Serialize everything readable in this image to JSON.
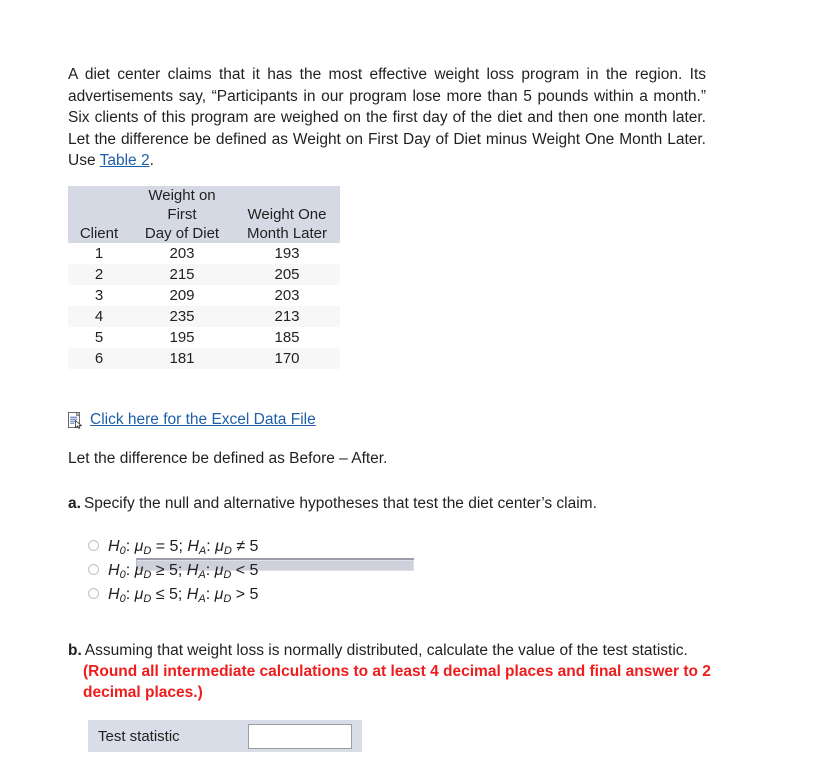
{
  "intro": {
    "line1": "A diet center claims that it has the most effective weight loss program in the",
    "line2": "region. Its advertisements say, “Participants in our program lose more than 5",
    "line3": "pounds within a month.” Six clients of this program are weighed on the first",
    "line4": "day of the diet and then one month later. Let the difference be defined as",
    "line5_before": "Weight on First Day of Diet minus Weight One Month Later. Use ",
    "table_link": "Table 2",
    "line5_after": "."
  },
  "table": {
    "headers": {
      "client": "Client",
      "first_day_l1": "Weight on",
      "first_day_l2": "First",
      "first_day_l3": "Day of Diet",
      "month_later_l1": "Weight One",
      "month_later_l2": "Month Later"
    },
    "rows": [
      {
        "client": "1",
        "first_day": "203",
        "month_later": "193"
      },
      {
        "client": "2",
        "first_day": "215",
        "month_later": "205"
      },
      {
        "client": "3",
        "first_day": "209",
        "month_later": "203"
      },
      {
        "client": "4",
        "first_day": "235",
        "month_later": "213"
      },
      {
        "client": "5",
        "first_day": "195",
        "month_later": "185"
      },
      {
        "client": "6",
        "first_day": "181",
        "month_later": "170"
      }
    ]
  },
  "excel": {
    "link_text": "Click here for the Excel Data File",
    "icon": "excel-file-icon"
  },
  "difference_note": "Let the difference be defined as Before – After.",
  "part_a": {
    "label": "a.",
    "text": "Specify the null and alternative hypotheses that test the diet center’s claim.",
    "options": [
      {
        "h0_symbol": "H",
        "h0_sub": "0",
        "h0_mu": "μ",
        "h0_mu_sub": "D",
        "h0_rel": "=",
        "h0_val": "5",
        "ha_symbol": "H",
        "ha_sub": "A",
        "ha_mu": "μ",
        "ha_mu_sub": "D",
        "ha_rel": "≠",
        "ha_val": "5",
        "selected": false
      },
      {
        "h0_symbol": "H",
        "h0_sub": "0",
        "h0_mu": "μ",
        "h0_mu_sub": "D",
        "h0_rel": "≥",
        "h0_val": "5",
        "ha_symbol": "H",
        "ha_sub": "A",
        "ha_mu": "μ",
        "ha_mu_sub": "D",
        "ha_rel": "<",
        "ha_val": "5",
        "selected": false
      },
      {
        "h0_symbol": "H",
        "h0_sub": "0",
        "h0_mu": "μ",
        "h0_mu_sub": "D",
        "h0_rel": "≤",
        "h0_val": "5",
        "ha_symbol": "H",
        "ha_sub": "A",
        "ha_mu": "μ",
        "ha_mu_sub": "D",
        "ha_rel": ">",
        "ha_val": "5",
        "selected": false
      }
    ]
  },
  "part_b": {
    "label": "b.",
    "text": "Assuming that weight loss is normally distributed, calculate the value of the test statistic. ",
    "red_text": "(Round all intermediate calculations to at least 4 decimal places and final answer to 2 decimal places.)",
    "answer_label": "Test statistic",
    "answer_value": "",
    "answer_placeholder": ""
  },
  "colors": {
    "link": "#1f5fa9",
    "header_bg": "#d4d9e4",
    "row_alt_bg": "#f7f7f7",
    "red_emphasis": "#ee1c1c",
    "answer_row_bg": "#d9dde7"
  }
}
